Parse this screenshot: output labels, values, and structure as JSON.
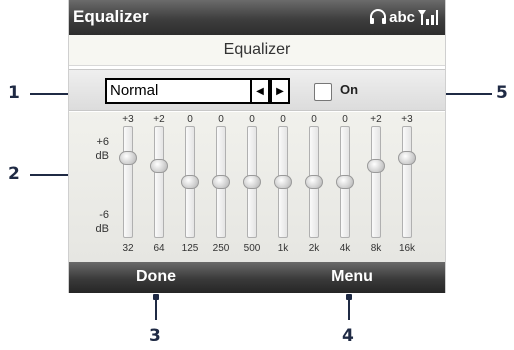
{
  "window": {
    "title": "Equalizer",
    "status_text": "abc"
  },
  "header": {
    "subtitle": "Equalizer"
  },
  "preset": {
    "value": "Normal",
    "prev_icon": "triangle-left-icon",
    "next_icon": "triangle-right-icon"
  },
  "toggle": {
    "label": "On",
    "checked": false
  },
  "scale": {
    "top": "+6",
    "top_unit": "dB",
    "bottom": "-6",
    "bottom_unit": "dB"
  },
  "bands": [
    {
      "freq": "32",
      "gain": "+3"
    },
    {
      "freq": "64",
      "gain": "+2"
    },
    {
      "freq": "125",
      "gain": "0"
    },
    {
      "freq": "250",
      "gain": "0"
    },
    {
      "freq": "500",
      "gain": "0"
    },
    {
      "freq": "1k",
      "gain": "0"
    },
    {
      "freq": "2k",
      "gain": "0"
    },
    {
      "freq": "4k",
      "gain": "0"
    },
    {
      "freq": "8k",
      "gain": "+2"
    },
    {
      "freq": "16k",
      "gain": "+3"
    }
  ],
  "softkeys": {
    "left": "Done",
    "right": "Menu"
  },
  "callouts": {
    "c1": "1",
    "c2": "2",
    "c3": "3",
    "c4": "4",
    "c5": "5"
  },
  "colors": {
    "callout": "#1f2a44",
    "bar_dark": "#2d2d2d"
  }
}
